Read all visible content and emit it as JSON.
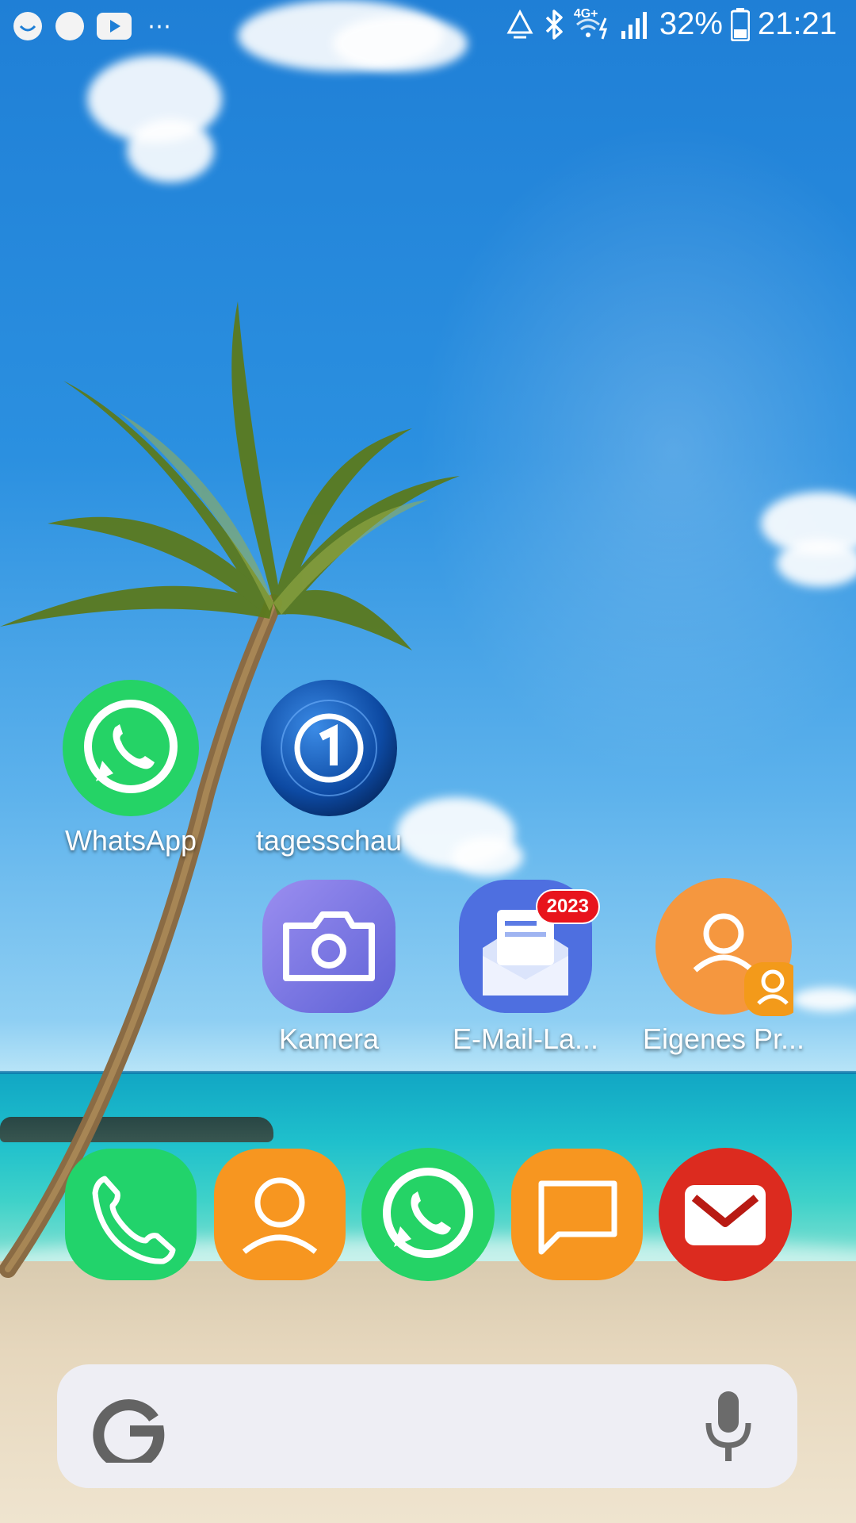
{
  "status_bar": {
    "battery_percent": "32%",
    "time": "21:21",
    "network_label": "4G+",
    "left_icons": [
      "emoji-icon",
      "circle-icon",
      "youtube-icon",
      "more-dots-icon"
    ],
    "right_icons": [
      "recycle-icon",
      "bluetooth-icon",
      "4g-wifi-icon",
      "signal-icon",
      "battery-icon"
    ]
  },
  "apps": [
    {
      "label": "WhatsApp",
      "icon": "whatsapp-icon",
      "color": "#25d366"
    },
    {
      "label": "tagesschau",
      "icon": "tagesschau-icon",
      "color": "#0c4fa8"
    },
    {
      "label": "Kamera",
      "icon": "camera-icon",
      "color": "#7b72e0"
    },
    {
      "label": "E-Mail-La...",
      "icon": "email-icon",
      "color": "#4e6fe0",
      "badge": "2023"
    },
    {
      "label": "Eigenes Pr...",
      "icon": "profile-icon",
      "color": "#f5973f"
    }
  ],
  "dock": [
    {
      "icon": "phone-icon",
      "color": "#22d36b"
    },
    {
      "icon": "contacts-icon",
      "color": "#f79620"
    },
    {
      "icon": "whatsapp-icon",
      "color": "#25d366"
    },
    {
      "icon": "messages-icon",
      "color": "#f79620"
    },
    {
      "icon": "mail-icon",
      "color": "#dc2b1f"
    }
  ],
  "search": {
    "placeholder": ""
  }
}
